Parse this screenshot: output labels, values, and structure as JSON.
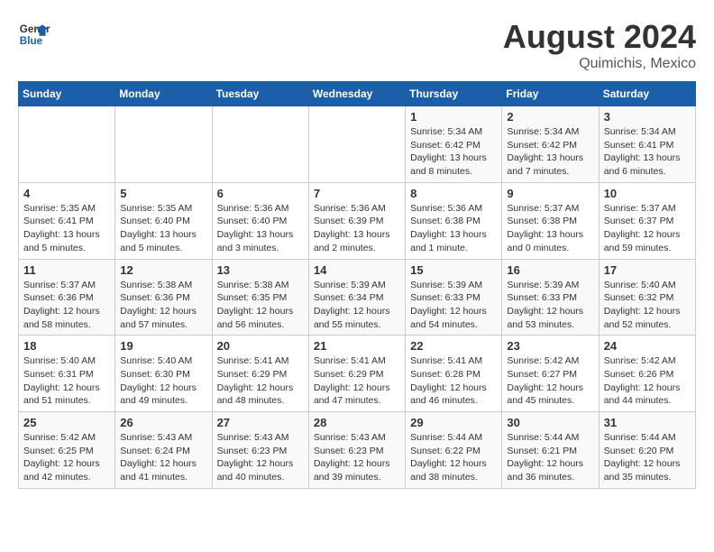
{
  "header": {
    "logo_general": "General",
    "logo_blue": "Blue",
    "month_year": "August 2024",
    "location": "Quimichis, Mexico"
  },
  "weekdays": [
    "Sunday",
    "Monday",
    "Tuesday",
    "Wednesday",
    "Thursday",
    "Friday",
    "Saturday"
  ],
  "weeks": [
    [
      {
        "day": "",
        "detail": ""
      },
      {
        "day": "",
        "detail": ""
      },
      {
        "day": "",
        "detail": ""
      },
      {
        "day": "",
        "detail": ""
      },
      {
        "day": "1",
        "detail": "Sunrise: 5:34 AM\nSunset: 6:42 PM\nDaylight: 13 hours\nand 8 minutes."
      },
      {
        "day": "2",
        "detail": "Sunrise: 5:34 AM\nSunset: 6:42 PM\nDaylight: 13 hours\nand 7 minutes."
      },
      {
        "day": "3",
        "detail": "Sunrise: 5:34 AM\nSunset: 6:41 PM\nDaylight: 13 hours\nand 6 minutes."
      }
    ],
    [
      {
        "day": "4",
        "detail": "Sunrise: 5:35 AM\nSunset: 6:41 PM\nDaylight: 13 hours\nand 5 minutes."
      },
      {
        "day": "5",
        "detail": "Sunrise: 5:35 AM\nSunset: 6:40 PM\nDaylight: 13 hours\nand 5 minutes."
      },
      {
        "day": "6",
        "detail": "Sunrise: 5:36 AM\nSunset: 6:40 PM\nDaylight: 13 hours\nand 3 minutes."
      },
      {
        "day": "7",
        "detail": "Sunrise: 5:36 AM\nSunset: 6:39 PM\nDaylight: 13 hours\nand 2 minutes."
      },
      {
        "day": "8",
        "detail": "Sunrise: 5:36 AM\nSunset: 6:38 PM\nDaylight: 13 hours\nand 1 minute."
      },
      {
        "day": "9",
        "detail": "Sunrise: 5:37 AM\nSunset: 6:38 PM\nDaylight: 13 hours\nand 0 minutes."
      },
      {
        "day": "10",
        "detail": "Sunrise: 5:37 AM\nSunset: 6:37 PM\nDaylight: 12 hours\nand 59 minutes."
      }
    ],
    [
      {
        "day": "11",
        "detail": "Sunrise: 5:37 AM\nSunset: 6:36 PM\nDaylight: 12 hours\nand 58 minutes."
      },
      {
        "day": "12",
        "detail": "Sunrise: 5:38 AM\nSunset: 6:36 PM\nDaylight: 12 hours\nand 57 minutes."
      },
      {
        "day": "13",
        "detail": "Sunrise: 5:38 AM\nSunset: 6:35 PM\nDaylight: 12 hours\nand 56 minutes."
      },
      {
        "day": "14",
        "detail": "Sunrise: 5:39 AM\nSunset: 6:34 PM\nDaylight: 12 hours\nand 55 minutes."
      },
      {
        "day": "15",
        "detail": "Sunrise: 5:39 AM\nSunset: 6:33 PM\nDaylight: 12 hours\nand 54 minutes."
      },
      {
        "day": "16",
        "detail": "Sunrise: 5:39 AM\nSunset: 6:33 PM\nDaylight: 12 hours\nand 53 minutes."
      },
      {
        "day": "17",
        "detail": "Sunrise: 5:40 AM\nSunset: 6:32 PM\nDaylight: 12 hours\nand 52 minutes."
      }
    ],
    [
      {
        "day": "18",
        "detail": "Sunrise: 5:40 AM\nSunset: 6:31 PM\nDaylight: 12 hours\nand 51 minutes."
      },
      {
        "day": "19",
        "detail": "Sunrise: 5:40 AM\nSunset: 6:30 PM\nDaylight: 12 hours\nand 49 minutes."
      },
      {
        "day": "20",
        "detail": "Sunrise: 5:41 AM\nSunset: 6:29 PM\nDaylight: 12 hours\nand 48 minutes."
      },
      {
        "day": "21",
        "detail": "Sunrise: 5:41 AM\nSunset: 6:29 PM\nDaylight: 12 hours\nand 47 minutes."
      },
      {
        "day": "22",
        "detail": "Sunrise: 5:41 AM\nSunset: 6:28 PM\nDaylight: 12 hours\nand 46 minutes."
      },
      {
        "day": "23",
        "detail": "Sunrise: 5:42 AM\nSunset: 6:27 PM\nDaylight: 12 hours\nand 45 minutes."
      },
      {
        "day": "24",
        "detail": "Sunrise: 5:42 AM\nSunset: 6:26 PM\nDaylight: 12 hours\nand 44 minutes."
      }
    ],
    [
      {
        "day": "25",
        "detail": "Sunrise: 5:42 AM\nSunset: 6:25 PM\nDaylight: 12 hours\nand 42 minutes."
      },
      {
        "day": "26",
        "detail": "Sunrise: 5:43 AM\nSunset: 6:24 PM\nDaylight: 12 hours\nand 41 minutes."
      },
      {
        "day": "27",
        "detail": "Sunrise: 5:43 AM\nSunset: 6:23 PM\nDaylight: 12 hours\nand 40 minutes."
      },
      {
        "day": "28",
        "detail": "Sunrise: 5:43 AM\nSunset: 6:23 PM\nDaylight: 12 hours\nand 39 minutes."
      },
      {
        "day": "29",
        "detail": "Sunrise: 5:44 AM\nSunset: 6:22 PM\nDaylight: 12 hours\nand 38 minutes."
      },
      {
        "day": "30",
        "detail": "Sunrise: 5:44 AM\nSunset: 6:21 PM\nDaylight: 12 hours\nand 36 minutes."
      },
      {
        "day": "31",
        "detail": "Sunrise: 5:44 AM\nSunset: 6:20 PM\nDaylight: 12 hours\nand 35 minutes."
      }
    ]
  ]
}
